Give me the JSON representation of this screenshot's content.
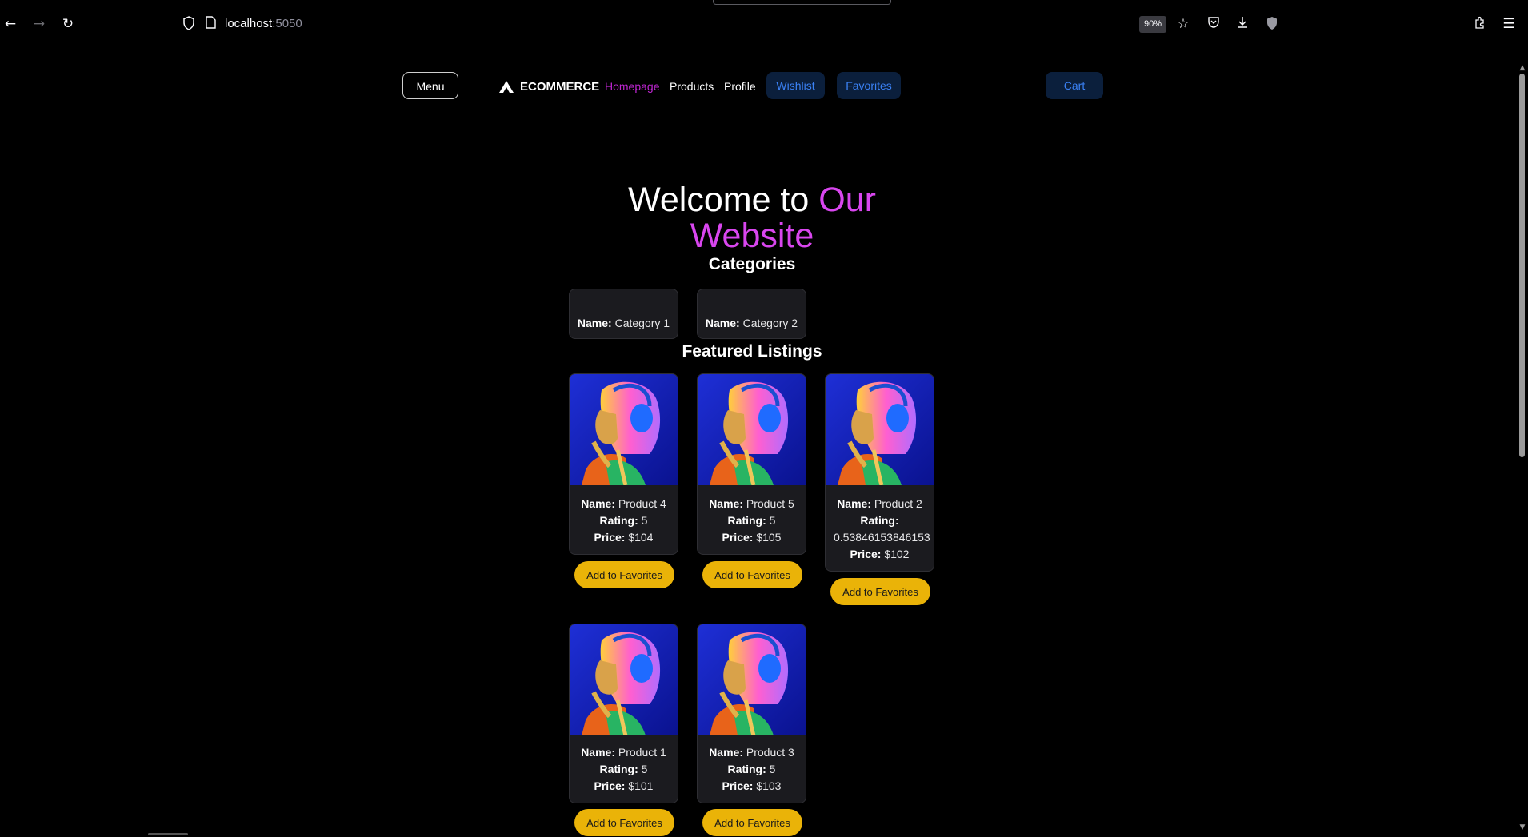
{
  "browser": {
    "url_host": "localhost",
    "url_port": ":5050",
    "zoom": "90%",
    "icons": [
      "back-icon",
      "forward-icon",
      "reload-icon",
      "shield-icon",
      "page-icon",
      "star-icon",
      "pocket-icon",
      "download-icon",
      "extension-shield-icon",
      "extensions-icon",
      "hamburger-menu-icon"
    ]
  },
  "nav": {
    "menu_label": "Menu",
    "brand": "ECOMMERCE",
    "links": [
      "Homepage",
      "Products",
      "Profile"
    ],
    "active_link": "Homepage",
    "wishlist_label": "Wishlist",
    "favorites_label": "Favorites",
    "cart_label": "Cart"
  },
  "hero": {
    "title_plain": "Welcome to ",
    "title_accent_1": "Our",
    "title_accent_2": "Website"
  },
  "categories": {
    "heading": "Categories",
    "name_label": "Name:",
    "items": [
      {
        "name": "Category 1"
      },
      {
        "name": "Category 2"
      }
    ]
  },
  "featured": {
    "heading": "Featured Listings",
    "name_label": "Name:",
    "rating_label": "Rating:",
    "price_label": "Price:",
    "button_label": "Add to Favorites",
    "products": [
      {
        "name": "Product 4",
        "rating": "5",
        "price": "$104"
      },
      {
        "name": "Product 5",
        "rating": "5",
        "price": "$105"
      },
      {
        "name": "Product 2",
        "rating": "0.53846153846153",
        "price": "$102"
      },
      {
        "name": "Product 1",
        "rating": "5",
        "price": "$101"
      },
      {
        "name": "Product 3",
        "rating": "5",
        "price": "$103"
      }
    ]
  },
  "colors": {
    "background": "#000000",
    "accent_magenta": "#d946ef",
    "pill_bg": "#0b1f3c",
    "pill_text": "#3b82f6",
    "button_yellow": "#eab308",
    "card_bg": "#1b1b1f"
  }
}
